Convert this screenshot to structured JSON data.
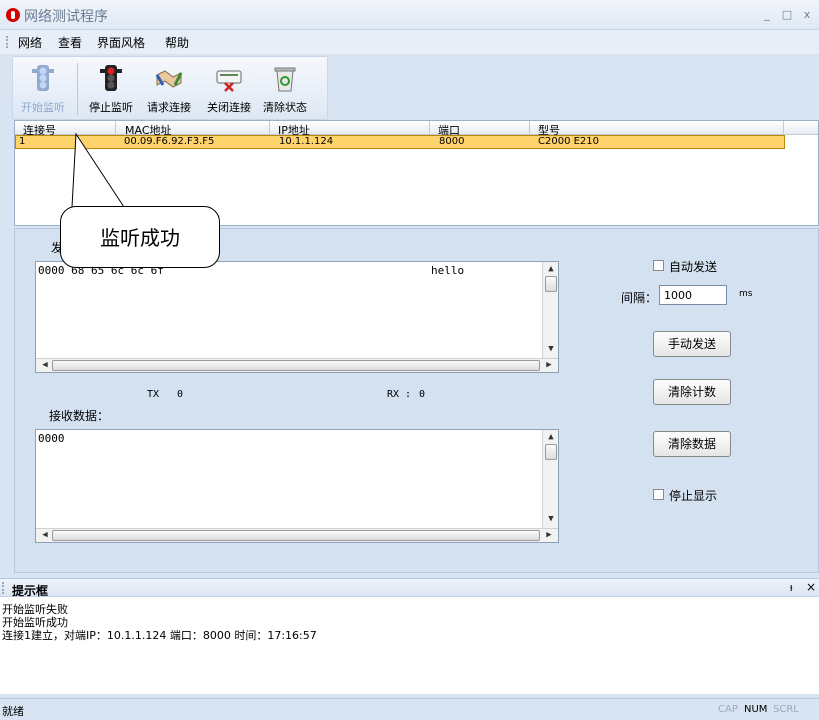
{
  "window": {
    "title": "网络测试程序",
    "minimize": "_",
    "maximize": "□",
    "close": "x"
  },
  "menu": [
    "网络",
    "查看",
    "界面风格",
    "帮助"
  ],
  "toolbar": {
    "start": "开始监听",
    "stop": "停止监听",
    "request": "请求连接",
    "close": "关闭连接",
    "clear": "清除状态"
  },
  "connections": {
    "headers": [
      "连接号",
      "MAC地址",
      "IP地址",
      "端口",
      "型号"
    ],
    "rows": [
      [
        "1",
        "00.09.F6.92.F3.F5",
        "10.1.1.124",
        "8000",
        "C2000 E210"
      ]
    ]
  },
  "callout": "监听成功",
  "send": {
    "label": "发",
    "content_hex": "0000 68 65 6c 6c 6f",
    "content_ascii": "hello",
    "tx_label": "TX",
    "tx": "0",
    "rx_label": "RX :",
    "rx": "0"
  },
  "receive": {
    "label": "接收数据：",
    "content": "0000"
  },
  "controls": {
    "auto_send": "自动发送",
    "interval_label": "间隔：",
    "interval_value": "1000",
    "interval_unit": "ms",
    "manual_send": "手动发送",
    "clear_count": "清除计数",
    "clear_data": "清除数据",
    "stop_display": "停止显示"
  },
  "hint": {
    "title": "提示框",
    "pin": "ᵼ",
    "close": "×",
    "lines": [
      "开始监听失败",
      "开始监听成功",
      "连接1建立，对端IP：10.1.1.124 端口：8000 时间：17:16:57"
    ]
  },
  "status": {
    "text": "就绪",
    "cap": "CAP",
    "num": "NUM",
    "scrl": "SCRL"
  },
  "colors": {
    "selected_row": "#ffd36b",
    "accent": "#d40000"
  }
}
